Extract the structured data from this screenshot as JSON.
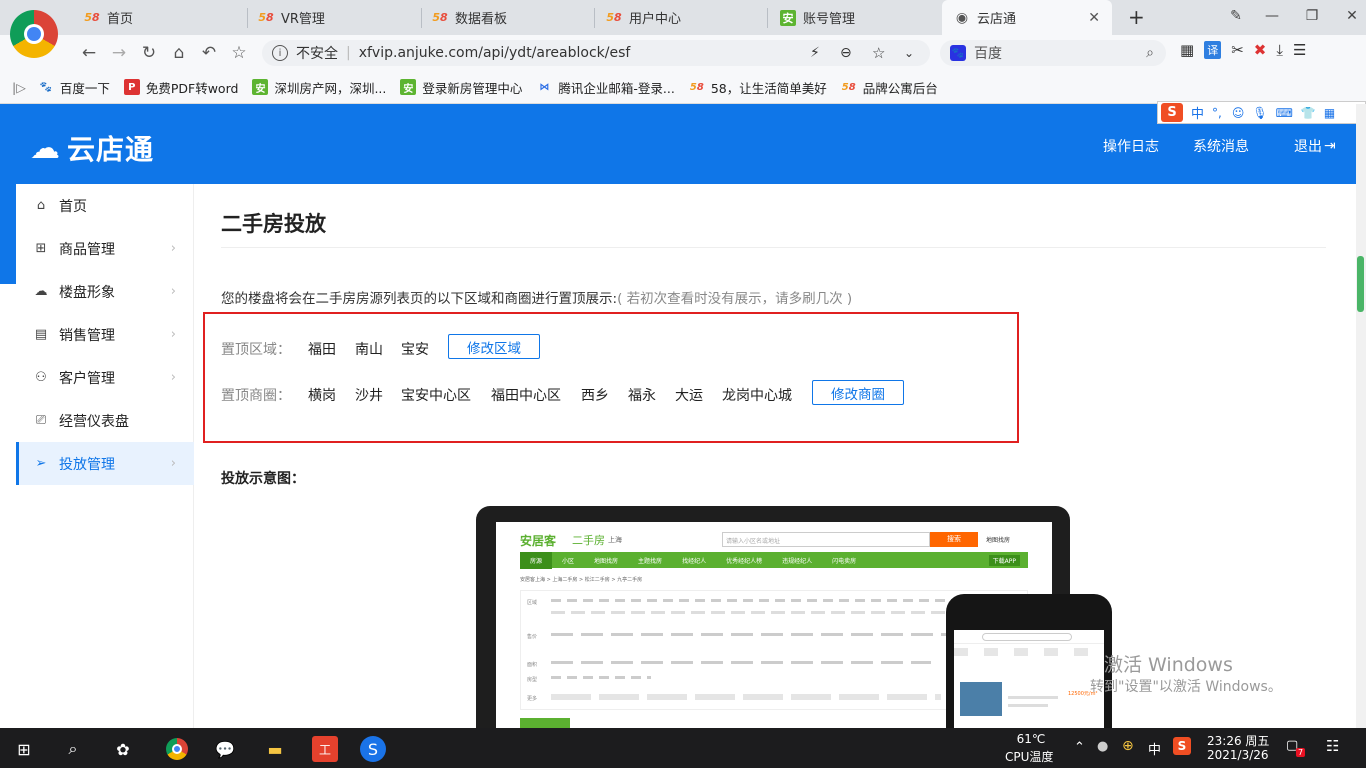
{
  "browser": {
    "tabs": [
      {
        "label": "首页",
        "favicon": "58-icon"
      },
      {
        "label": "VR管理",
        "favicon": "58-icon"
      },
      {
        "label": "数据看板",
        "favicon": "58-icon"
      },
      {
        "label": "用户中心",
        "favicon": "58-icon"
      },
      {
        "label": "账号管理",
        "favicon": "anjuke-icon"
      },
      {
        "label": "云店通",
        "favicon": "globe-icon",
        "active": true
      }
    ],
    "new_tab": "+",
    "security_label": "不安全",
    "url": "xfvip.anjuke.com/api/ydt/areablock/esf",
    "search_engine": "百度",
    "bookmarks": [
      {
        "label": "百度一下",
        "icon": "baidu-icon"
      },
      {
        "label": "免费PDF转word",
        "icon": "pdf-icon"
      },
      {
        "label": "深圳房产网，深圳...",
        "icon": "anjuke-icon"
      },
      {
        "label": "登录新房管理中心",
        "icon": "anjuke-icon"
      },
      {
        "label": "腾讯企业邮箱-登录...",
        "icon": "tencent-mail-icon"
      },
      {
        "label": "58，让生活简单美好",
        "icon": "58-icon"
      },
      {
        "label": "品牌公寓后台",
        "icon": "58-icon"
      }
    ]
  },
  "ime": {
    "label": "中",
    "symbols": "°,"
  },
  "app": {
    "logo": "云店通",
    "header_links": [
      "操作日志",
      "系统消息",
      "退出"
    ],
    "accent": "#0f76e8"
  },
  "sidebar": {
    "items": [
      {
        "label": "首页",
        "icon": "home-icon"
      },
      {
        "label": "商品管理",
        "icon": "grid-icon"
      },
      {
        "label": "楼盘形象",
        "icon": "cloud-icon"
      },
      {
        "label": "销售管理",
        "icon": "calendar-icon"
      },
      {
        "label": "客户管理",
        "icon": "user-icon"
      },
      {
        "label": "经营仪表盘",
        "icon": "monitor-icon"
      },
      {
        "label": "投放管理",
        "icon": "send-icon",
        "active": true
      }
    ]
  },
  "main": {
    "title": "二手房投放",
    "intro": "您的楼盘将会在二手房房源列表页的以下区域和商圈进行置顶展示:",
    "hint": "( 若初次查看时没有展示，请多刷几次 )",
    "area_label": "置顶区域：",
    "areas": [
      "福田",
      "南山",
      "宝安"
    ],
    "modify_area_button": "修改区域",
    "district_label": "置顶商圈：",
    "districts": [
      "横岗",
      "沙井",
      "宝安中心区",
      "福田中心区",
      "西乡",
      "福永",
      "大运",
      "龙岗中心城"
    ],
    "modify_district_button": "修改商圈",
    "demo_title": "投放示意图："
  },
  "mockup": {
    "brand": "安居客",
    "section": "二手房",
    "city": "上海",
    "search_placeholder": "请输入小区名或地址",
    "search_button": "搜索",
    "map_link": "地图找房",
    "nav": [
      "房源",
      "小区",
      "地图找房",
      "主题找房",
      "找经纪人",
      "优秀经纪人榜",
      "违规经纪人",
      "闪电卖房"
    ],
    "download": "下载APP",
    "breadcrumb": "安居客上海 > 上海二手房 > 松江二手房 > 九亭二手房",
    "filters": [
      "区域",
      "售价",
      "面积",
      "房型",
      "更多"
    ],
    "phone_price": "12500元/m²"
  },
  "watermark": {
    "line1": "激活 Windows",
    "line2": "转到\"设置\"以激活 Windows。"
  },
  "taskbar": {
    "weather": "61℃",
    "weather_label": "CPU温度",
    "ime": "中",
    "time": "23:26 周五",
    "date": "2021/3/26",
    "notif_count": "7"
  }
}
